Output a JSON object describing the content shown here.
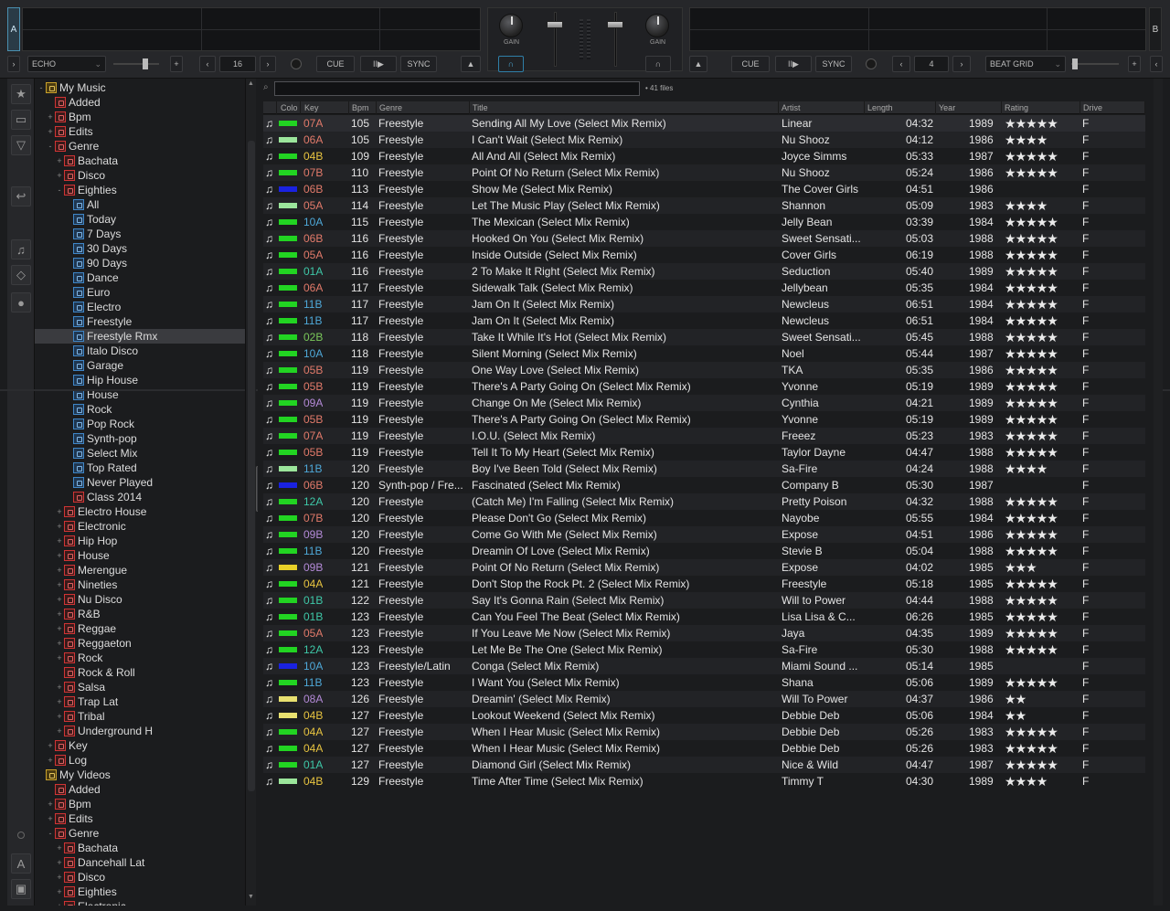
{
  "decks": {
    "a_letter": "A",
    "b_letter": "B",
    "a_effect": "ECHO",
    "a_loop": "16",
    "b_loop": "4",
    "b_effect": "BEAT GRID",
    "cue": "CUE",
    "play": "II▶",
    "sync": "SYNC",
    "gain": "GAIN"
  },
  "search": {
    "count": "41 files"
  },
  "columns": {
    "color": "Colo",
    "key": "Key",
    "bpm": "Bpm",
    "genre": "Genre",
    "title": "Title",
    "artist": "Artist",
    "length": "Length",
    "year": "Year",
    "rating": "Rating",
    "drive": "Drive"
  },
  "tree": [
    {
      "label": "My Music",
      "depth": 0,
      "exp": "-",
      "icon": "gold"
    },
    {
      "label": "Added",
      "depth": 1,
      "exp": "",
      "icon": "red"
    },
    {
      "label": "Bpm",
      "depth": 1,
      "exp": "+",
      "icon": "red"
    },
    {
      "label": "Edits",
      "depth": 1,
      "exp": "+",
      "icon": "red"
    },
    {
      "label": "Genre",
      "depth": 1,
      "exp": "-",
      "icon": "red"
    },
    {
      "label": "Bachata",
      "depth": 2,
      "exp": "+",
      "icon": "red"
    },
    {
      "label": "Disco",
      "depth": 2,
      "exp": "+",
      "icon": "red"
    },
    {
      "label": "Eighties",
      "depth": 2,
      "exp": "-",
      "icon": "red"
    },
    {
      "label": "All",
      "depth": 3,
      "exp": "",
      "icon": "blue"
    },
    {
      "label": "Today",
      "depth": 3,
      "exp": "",
      "icon": "blue"
    },
    {
      "label": "7 Days",
      "depth": 3,
      "exp": "",
      "icon": "blue"
    },
    {
      "label": "30 Days",
      "depth": 3,
      "exp": "",
      "icon": "blue"
    },
    {
      "label": "90 Days",
      "depth": 3,
      "exp": "",
      "icon": "blue"
    },
    {
      "label": "Dance",
      "depth": 3,
      "exp": "",
      "icon": "blue"
    },
    {
      "label": "Euro",
      "depth": 3,
      "exp": "",
      "icon": "blue"
    },
    {
      "label": "Electro",
      "depth": 3,
      "exp": "",
      "icon": "blue"
    },
    {
      "label": "Freestyle",
      "depth": 3,
      "exp": "",
      "icon": "blue"
    },
    {
      "label": "Freestyle Rmx",
      "depth": 3,
      "exp": "",
      "icon": "blue",
      "selected": true
    },
    {
      "label": "Italo Disco",
      "depth": 3,
      "exp": "",
      "icon": "blue"
    },
    {
      "label": "Garage",
      "depth": 3,
      "exp": "",
      "icon": "blue"
    },
    {
      "label": "Hip House",
      "depth": 3,
      "exp": "",
      "icon": "blue"
    },
    {
      "label": "House",
      "depth": 3,
      "exp": "",
      "icon": "blue"
    },
    {
      "label": "Rock",
      "depth": 3,
      "exp": "",
      "icon": "blue"
    },
    {
      "label": "Pop Rock",
      "depth": 3,
      "exp": "",
      "icon": "blue"
    },
    {
      "label": "Synth-pop",
      "depth": 3,
      "exp": "",
      "icon": "blue"
    },
    {
      "label": "Select Mix",
      "depth": 3,
      "exp": "",
      "icon": "blue"
    },
    {
      "label": "Top Rated",
      "depth": 3,
      "exp": "",
      "icon": "blue"
    },
    {
      "label": "Never Played",
      "depth": 3,
      "exp": "",
      "icon": "blue"
    },
    {
      "label": "Class 2014",
      "depth": 3,
      "exp": "",
      "icon": "red"
    },
    {
      "label": "Electro House",
      "depth": 2,
      "exp": "+",
      "icon": "red"
    },
    {
      "label": "Electronic",
      "depth": 2,
      "exp": "+",
      "icon": "red"
    },
    {
      "label": "Hip Hop",
      "depth": 2,
      "exp": "+",
      "icon": "red"
    },
    {
      "label": "House",
      "depth": 2,
      "exp": "+",
      "icon": "red"
    },
    {
      "label": "Merengue",
      "depth": 2,
      "exp": "+",
      "icon": "red"
    },
    {
      "label": "Nineties",
      "depth": 2,
      "exp": "+",
      "icon": "red"
    },
    {
      "label": "Nu Disco",
      "depth": 2,
      "exp": "+",
      "icon": "red"
    },
    {
      "label": "R&B",
      "depth": 2,
      "exp": "+",
      "icon": "red"
    },
    {
      "label": "Reggae",
      "depth": 2,
      "exp": "+",
      "icon": "red"
    },
    {
      "label": "Reggaeton",
      "depth": 2,
      "exp": "+",
      "icon": "red"
    },
    {
      "label": "Rock",
      "depth": 2,
      "exp": "+",
      "icon": "red"
    },
    {
      "label": "Rock & Roll",
      "depth": 2,
      "exp": "",
      "icon": "red"
    },
    {
      "label": "Salsa",
      "depth": 2,
      "exp": "+",
      "icon": "red"
    },
    {
      "label": "Trap Lat",
      "depth": 2,
      "exp": "+",
      "icon": "red"
    },
    {
      "label": "Tribal",
      "depth": 2,
      "exp": "+",
      "icon": "red"
    },
    {
      "label": "Underground H",
      "depth": 2,
      "exp": "+",
      "icon": "red"
    },
    {
      "label": "Key",
      "depth": 1,
      "exp": "+",
      "icon": "red"
    },
    {
      "label": "Log",
      "depth": 1,
      "exp": "+",
      "icon": "red"
    },
    {
      "label": "My Videos",
      "depth": 0,
      "exp": "",
      "icon": "gold"
    },
    {
      "label": "Added",
      "depth": 1,
      "exp": "",
      "icon": "red"
    },
    {
      "label": "Bpm",
      "depth": 1,
      "exp": "+",
      "icon": "red"
    },
    {
      "label": "Edits",
      "depth": 1,
      "exp": "+",
      "icon": "red"
    },
    {
      "label": "Genre",
      "depth": 1,
      "exp": "-",
      "icon": "red"
    },
    {
      "label": "Bachata",
      "depth": 2,
      "exp": "+",
      "icon": "red"
    },
    {
      "label": "Dancehall Lat",
      "depth": 2,
      "exp": "+",
      "icon": "red"
    },
    {
      "label": "Disco",
      "depth": 2,
      "exp": "+",
      "icon": "red"
    },
    {
      "label": "Eighties",
      "depth": 2,
      "exp": "+",
      "icon": "red"
    },
    {
      "label": "Electronic",
      "depth": 2,
      "exp": "+",
      "icon": "red"
    }
  ],
  "tracks": [
    {
      "color": "#22d422",
      "key": "07A",
      "keycolor": "#e27a6a",
      "bpm": "105",
      "genre": "Freestyle",
      "title": "Sending All My Love (Select Mix Remix)",
      "artist": "Linear",
      "length": "04:32",
      "year": "1989",
      "rating": 5
    },
    {
      "color": "#9be59b",
      "key": "06A",
      "keycolor": "#e27a6a",
      "bpm": "105",
      "genre": "Freestyle",
      "title": "I Can't Wait (Select Mix Remix)",
      "artist": "Nu Shooz",
      "length": "04:12",
      "year": "1986",
      "rating": 4
    },
    {
      "color": "#22d422",
      "key": "04B",
      "keycolor": "#e8c440",
      "bpm": "109",
      "genre": "Freestyle",
      "title": "All And All (Select Mix Remix)",
      "artist": "Joyce Simms",
      "length": "05:33",
      "year": "1987",
      "rating": 5
    },
    {
      "color": "#22d422",
      "key": "07B",
      "keycolor": "#e27a6a",
      "bpm": "110",
      "genre": "Freestyle",
      "title": "Point Of No Return (Select Mix Remix)",
      "artist": "Nu Shooz",
      "length": "05:24",
      "year": "1986",
      "rating": 5
    },
    {
      "color": "#1a22e0",
      "key": "06B",
      "keycolor": "#e27a6a",
      "bpm": "113",
      "genre": "Freestyle",
      "title": "Show Me (Select Mix Remix)",
      "artist": "The Cover Girls",
      "length": "04:51",
      "year": "1986",
      "rating": 0
    },
    {
      "color": "#9be59b",
      "key": "05A",
      "keycolor": "#e27a6a",
      "bpm": "114",
      "genre": "Freestyle",
      "title": "Let The Music Play (Select Mix Remix)",
      "artist": "Shannon",
      "length": "05:09",
      "year": "1983",
      "rating": 4
    },
    {
      "color": "#22d422",
      "key": "10A",
      "keycolor": "#4ea8d8",
      "bpm": "115",
      "genre": "Freestyle",
      "title": "The Mexican (Select Mix Remix)",
      "artist": "Jelly Bean",
      "length": "03:39",
      "year": "1984",
      "rating": 5
    },
    {
      "color": "#22d422",
      "key": "06B",
      "keycolor": "#e27a6a",
      "bpm": "116",
      "genre": "Freestyle",
      "title": "Hooked On You (Select Mix Remix)",
      "artist": "Sweet Sensati...",
      "length": "05:03",
      "year": "1988",
      "rating": 5
    },
    {
      "color": "#22d422",
      "key": "05A",
      "keycolor": "#e27a6a",
      "bpm": "116",
      "genre": "Freestyle",
      "title": "Inside Outside (Select Mix Remix)",
      "artist": "Cover Girls",
      "length": "06:19",
      "year": "1988",
      "rating": 5
    },
    {
      "color": "#22d422",
      "key": "01A",
      "keycolor": "#3ec8a8",
      "bpm": "116",
      "genre": "Freestyle",
      "title": "2 To Make It Right (Select Mix Remix)",
      "artist": "Seduction",
      "length": "05:40",
      "year": "1989",
      "rating": 5
    },
    {
      "color": "#22d422",
      "key": "06A",
      "keycolor": "#e27a6a",
      "bpm": "117",
      "genre": "Freestyle",
      "title": "Sidewalk Talk (Select Mix Remix)",
      "artist": "Jellybean",
      "length": "05:35",
      "year": "1984",
      "rating": 5
    },
    {
      "color": "#22d422",
      "key": "11B",
      "keycolor": "#4ea8d8",
      "bpm": "117",
      "genre": "Freestyle",
      "title": "Jam On It (Select Mix Remix)",
      "artist": "Newcleus",
      "length": "06:51",
      "year": "1984",
      "rating": 5
    },
    {
      "color": "#22d422",
      "key": "11B",
      "keycolor": "#4ea8d8",
      "bpm": "117",
      "genre": "Freestyle",
      "title": "Jam On It (Select Mix Remix)",
      "artist": "Newcleus",
      "length": "06:51",
      "year": "1984",
      "rating": 5
    },
    {
      "color": "#22d422",
      "key": "02B",
      "keycolor": "#7ac85a",
      "bpm": "118",
      "genre": "Freestyle",
      "title": "Take It While It's Hot (Select Mix Remix)",
      "artist": "Sweet Sensati...",
      "length": "05:45",
      "year": "1988",
      "rating": 5
    },
    {
      "color": "#22d422",
      "key": "10A",
      "keycolor": "#4ea8d8",
      "bpm": "118",
      "genre": "Freestyle",
      "title": "Silent Morning (Select Mix Remix)",
      "artist": "Noel",
      "length": "05:44",
      "year": "1987",
      "rating": 5
    },
    {
      "color": "#22d422",
      "key": "05B",
      "keycolor": "#e27a6a",
      "bpm": "119",
      "genre": "Freestyle",
      "title": "One Way Love (Select Mix Remix)",
      "artist": "TKA",
      "length": "05:35",
      "year": "1986",
      "rating": 5
    },
    {
      "color": "#22d422",
      "key": "05B",
      "keycolor": "#e27a6a",
      "bpm": "119",
      "genre": "Freestyle",
      "title": "There's A Party Going On (Select Mix Remix)",
      "artist": "Yvonne",
      "length": "05:19",
      "year": "1989",
      "rating": 5
    },
    {
      "color": "#22d422",
      "key": "09A",
      "keycolor": "#b48ad8",
      "bpm": "119",
      "genre": "Freestyle",
      "title": "Change On Me (Select Mix Remix)",
      "artist": "Cynthia",
      "length": "04:21",
      "year": "1989",
      "rating": 5
    },
    {
      "color": "#22d422",
      "key": "05B",
      "keycolor": "#e27a6a",
      "bpm": "119",
      "genre": "Freestyle",
      "title": "There's A Party Going On (Select Mix Remix)",
      "artist": "Yvonne",
      "length": "05:19",
      "year": "1989",
      "rating": 5
    },
    {
      "color": "#22d422",
      "key": "07A",
      "keycolor": "#e27a6a",
      "bpm": "119",
      "genre": "Freestyle",
      "title": "I.O.U. (Select Mix Remix)",
      "artist": "Freeez",
      "length": "05:23",
      "year": "1983",
      "rating": 5
    },
    {
      "color": "#22d422",
      "key": "05B",
      "keycolor": "#e27a6a",
      "bpm": "119",
      "genre": "Freestyle",
      "title": "Tell It To My Heart (Select Mix Remix)",
      "artist": "Taylor Dayne",
      "length": "04:47",
      "year": "1988",
      "rating": 5
    },
    {
      "color": "#9be59b",
      "key": "11B",
      "keycolor": "#4ea8d8",
      "bpm": "120",
      "genre": "Freestyle",
      "title": "Boy I've Been Told (Select Mix Remix)",
      "artist": "Sa-Fire",
      "length": "04:24",
      "year": "1988",
      "rating": 4
    },
    {
      "color": "#1a22e0",
      "key": "06B",
      "keycolor": "#e27a6a",
      "bpm": "120",
      "genre": "Synth-pop / Fre...",
      "title": "Fascinated (Select Mix Remix)",
      "artist": "Company B",
      "length": "05:30",
      "year": "1987",
      "rating": 0
    },
    {
      "color": "#22d422",
      "key": "12A",
      "keycolor": "#3ec8a8",
      "bpm": "120",
      "genre": "Freestyle",
      "title": "(Catch Me) I'm Falling (Select Mix Remix)",
      "artist": "Pretty Poison",
      "length": "04:32",
      "year": "1988",
      "rating": 5
    },
    {
      "color": "#22d422",
      "key": "07B",
      "keycolor": "#e27a6a",
      "bpm": "120",
      "genre": "Freestyle",
      "title": "Please Don't Go (Select Mix Remix)",
      "artist": "Nayobe",
      "length": "05:55",
      "year": "1984",
      "rating": 5
    },
    {
      "color": "#22d422",
      "key": "09B",
      "keycolor": "#b48ad8",
      "bpm": "120",
      "genre": "Freestyle",
      "title": "Come Go With Me (Select Mix Remix)",
      "artist": "Expose",
      "length": "04:51",
      "year": "1986",
      "rating": 5
    },
    {
      "color": "#22d422",
      "key": "11B",
      "keycolor": "#4ea8d8",
      "bpm": "120",
      "genre": "Freestyle",
      "title": "Dreamin Of Love (Select Mix Remix)",
      "artist": "Stevie B",
      "length": "05:04",
      "year": "1988",
      "rating": 5
    },
    {
      "color": "#e8d028",
      "key": "09B",
      "keycolor": "#b48ad8",
      "bpm": "121",
      "genre": "Freestyle",
      "title": "Point Of No Return (Select Mix Remix)",
      "artist": "Expose",
      "length": "04:02",
      "year": "1985",
      "rating": 3
    },
    {
      "color": "#22d422",
      "key": "04A",
      "keycolor": "#e8c440",
      "bpm": "121",
      "genre": "Freestyle",
      "title": "Don't Stop the Rock Pt. 2 (Select Mix Remix)",
      "artist": "Freestyle",
      "length": "05:18",
      "year": "1985",
      "rating": 5
    },
    {
      "color": "#22d422",
      "key": "01B",
      "keycolor": "#3ec8a8",
      "bpm": "122",
      "genre": "Freestyle",
      "title": "Say It's Gonna Rain (Select Mix Remix)",
      "artist": "Will to Power",
      "length": "04:44",
      "year": "1988",
      "rating": 5
    },
    {
      "color": "#22d422",
      "key": "01B",
      "keycolor": "#3ec8a8",
      "bpm": "123",
      "genre": "Freestyle",
      "title": "Can You Feel The Beat (Select Mix Remix)",
      "artist": "Lisa Lisa & C...",
      "length": "06:26",
      "year": "1985",
      "rating": 5
    },
    {
      "color": "#22d422",
      "key": "05A",
      "keycolor": "#e27a6a",
      "bpm": "123",
      "genre": "Freestyle",
      "title": "If You Leave Me Now (Select Mix Remix)",
      "artist": "Jaya",
      "length": "04:35",
      "year": "1989",
      "rating": 5
    },
    {
      "color": "#22d422",
      "key": "12A",
      "keycolor": "#3ec8a8",
      "bpm": "123",
      "genre": "Freestyle",
      "title": "Let Me Be The One (Select Mix Remix)",
      "artist": "Sa-Fire",
      "length": "05:30",
      "year": "1988",
      "rating": 5
    },
    {
      "color": "#1a22e0",
      "key": "10A",
      "keycolor": "#4ea8d8",
      "bpm": "123",
      "genre": "Freestyle/Latin",
      "title": "Conga (Select Mix Remix)",
      "artist": "Miami Sound ...",
      "length": "05:14",
      "year": "1985",
      "rating": 0
    },
    {
      "color": "#22d422",
      "key": "11B",
      "keycolor": "#4ea8d8",
      "bpm": "123",
      "genre": "Freestyle",
      "title": "I Want You (Select Mix Remix)",
      "artist": "Shana",
      "length": "05:06",
      "year": "1989",
      "rating": 5
    },
    {
      "color": "#e8e070",
      "key": "08A",
      "keycolor": "#b48ad8",
      "bpm": "126",
      "genre": "Freestyle",
      "title": "Dreamin' (Select Mix Remix)",
      "artist": "Will To Power",
      "length": "04:37",
      "year": "1986",
      "rating": 2
    },
    {
      "color": "#e8e070",
      "key": "04B",
      "keycolor": "#e8c440",
      "bpm": "127",
      "genre": "Freestyle",
      "title": "Lookout Weekend (Select Mix Remix)",
      "artist": "Debbie Deb",
      "length": "05:06",
      "year": "1984",
      "rating": 2
    },
    {
      "color": "#22d422",
      "key": "04A",
      "keycolor": "#e8c440",
      "bpm": "127",
      "genre": "Freestyle",
      "title": "When I Hear Music (Select Mix Remix)",
      "artist": "Debbie Deb",
      "length": "05:26",
      "year": "1983",
      "rating": 5
    },
    {
      "color": "#22d422",
      "key": "04A",
      "keycolor": "#e8c440",
      "bpm": "127",
      "genre": "Freestyle",
      "title": "When I Hear Music (Select Mix Remix)",
      "artist": "Debbie Deb",
      "length": "05:26",
      "year": "1983",
      "rating": 5
    },
    {
      "color": "#22d422",
      "key": "01A",
      "keycolor": "#3ec8a8",
      "bpm": "127",
      "genre": "Freestyle",
      "title": "Diamond Girl (Select Mix Remix)",
      "artist": "Nice & Wild",
      "length": "04:47",
      "year": "1987",
      "rating": 5
    },
    {
      "color": "#9be59b",
      "key": "04B",
      "keycolor": "#e8c440",
      "bpm": "129",
      "genre": "Freestyle",
      "title": "Time After Time  (Select Mix Remix)",
      "artist": "Timmy T",
      "length": "04:30",
      "year": "1989",
      "rating": 4
    }
  ],
  "drive": "F",
  "side_tabs": {
    "left": "folders",
    "right": "info"
  }
}
